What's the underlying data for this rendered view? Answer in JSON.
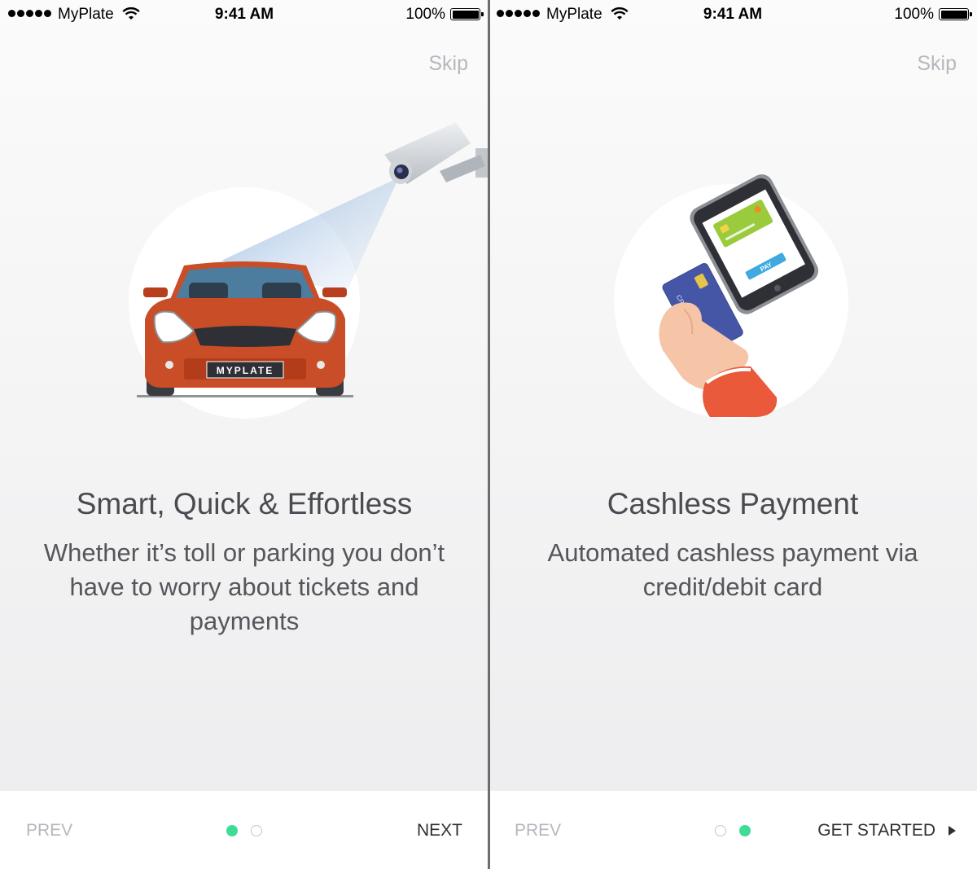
{
  "status_bar": {
    "carrier": "MyPlate",
    "time": "9:41 AM",
    "battery": "100%"
  },
  "screens": [
    {
      "skip_label": "Skip",
      "plate_text": "MYPLATE",
      "title": "Smart, Quick & Effortless",
      "description": "Whether it’s toll or parking you don’t have to worry about tickets and payments",
      "prev_label": "PREV",
      "next_label": "NEXT",
      "active_page": 1,
      "total_pages": 2
    },
    {
      "skip_label": "Skip",
      "card_text": "CREDIT CARD",
      "pay_text": "PAY",
      "title": "Cashless Payment",
      "description": "Automated cashless payment via credit/debit card",
      "prev_label": "PREV",
      "next_label": "GET STARTED",
      "active_page": 2,
      "total_pages": 2
    }
  ],
  "colors": {
    "accent": "#3ddc97",
    "car": "#c94d26",
    "skip": "#b5b8bd",
    "title": "#4a4b50"
  }
}
